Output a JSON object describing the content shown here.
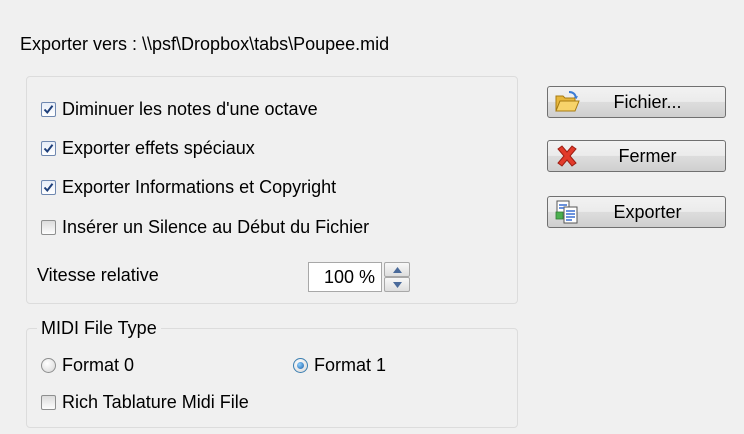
{
  "export_path_label": "Exporter vers : \\\\psf\\Dropbox\\tabs\\Poupee.mid",
  "options": {
    "lower_octave": {
      "label": "Diminuer les notes d'une octave",
      "checked": true
    },
    "export_effects": {
      "label": "Exporter effets spéciaux",
      "checked": true
    },
    "export_info": {
      "label": "Exporter Informations et Copyright",
      "checked": true
    },
    "insert_silence": {
      "label": "Insérer un Silence au Début du Fichier",
      "checked": false
    },
    "speed_label": "Vitesse relative",
    "speed_value": "100 %"
  },
  "midi": {
    "legend": "MIDI File Type",
    "format0_label": "Format 0",
    "format1_label": "Format 1",
    "selected_format": 1,
    "rich_tab": {
      "label": "Rich Tablature Midi File",
      "checked": false
    }
  },
  "buttons": {
    "file_label": "Fichier...",
    "close_label": "Fermer",
    "export_label": "Exporter"
  },
  "icons": {
    "file": "folder-open-icon",
    "close": "red-x-icon",
    "export": "export-document-icon"
  }
}
